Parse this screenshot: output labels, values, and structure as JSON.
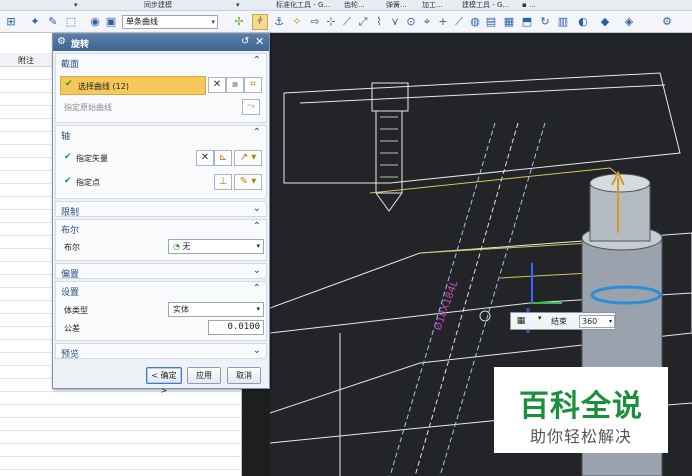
{
  "menubar": {
    "items": [
      "同步建模",
      "标准化工具 - G...",
      "齿轮...",
      "弹簧...",
      "加工...",
      "建模工具 - G...",
      "▪ ..."
    ]
  },
  "toolbar": {
    "curve_filter": "单条曲线"
  },
  "navigator": {
    "column_note": "附注"
  },
  "dialog": {
    "title": "旋转",
    "sections": {
      "section": {
        "label": "截面",
        "select_curve": "选择曲线 (12)",
        "origin_curve": "指定原始曲线"
      },
      "axis": {
        "label": "轴",
        "vector": "指定矢量",
        "point": "指定点"
      },
      "limits": {
        "label": "限制"
      },
      "boolean": {
        "label": "布尔",
        "field_label": "布尔",
        "value": "无"
      },
      "offset": {
        "label": "偏置"
      },
      "settings": {
        "label": "设置",
        "body_type_label": "体类型",
        "body_type_value": "实体",
        "tolerance_label": "公差",
        "tolerance_value": "0.0100"
      },
      "preview": {
        "label": "预览"
      }
    },
    "buttons": {
      "ok": "< 确定 >",
      "apply": "应用",
      "cancel": "取消"
    }
  },
  "viewport": {
    "dimension_label": "Ø18X184L",
    "mini_input": {
      "label": "结束",
      "value": "360"
    }
  },
  "watermark": {
    "title": "百科全说",
    "subtitle": "助你轻松解决"
  }
}
